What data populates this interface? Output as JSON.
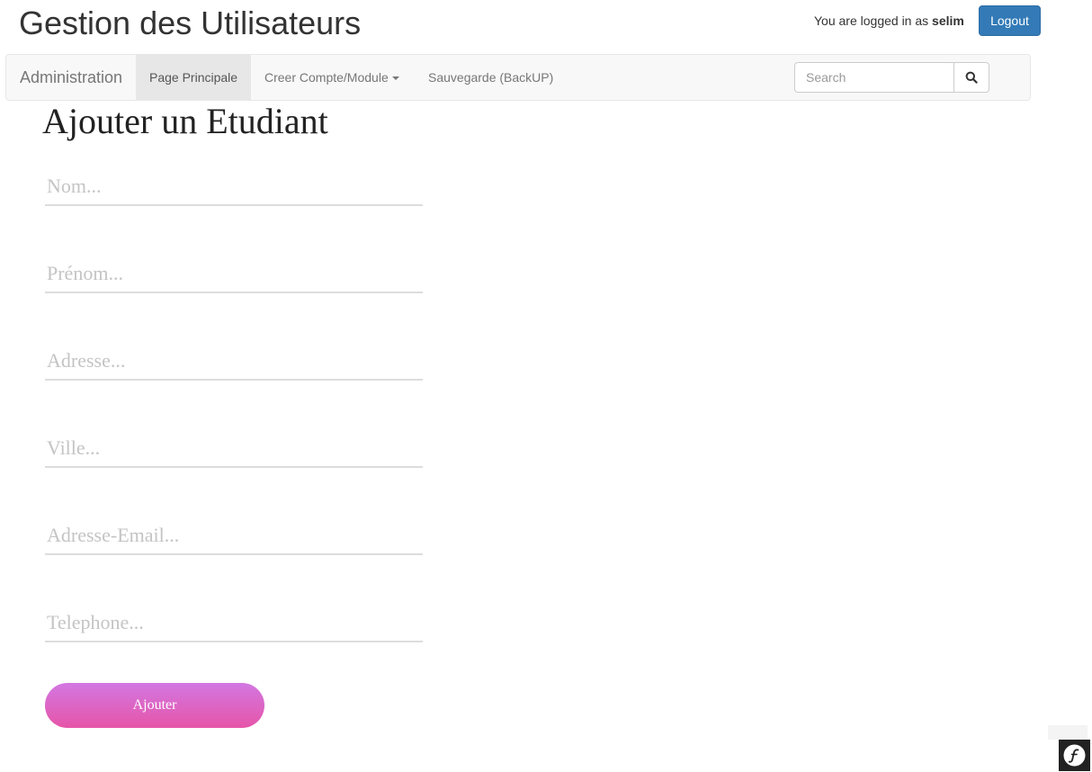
{
  "header": {
    "title": "Gestion des Utilisateurs",
    "login_prefix": "You are logged in as",
    "username": "selim",
    "logout_label": "Logout"
  },
  "navbar": {
    "brand": "Administration",
    "items": [
      {
        "label": "Page Principale",
        "active": true
      },
      {
        "label": "Creer Compte/Module",
        "dropdown": true
      },
      {
        "label": "Sauvegarde (BackUP)"
      }
    ],
    "search": {
      "placeholder": "Search",
      "icon": "search-icon"
    }
  },
  "form": {
    "title": "Ajouter un Etudiant",
    "fields": [
      {
        "name": "nom",
        "placeholder": "Nom...",
        "value": ""
      },
      {
        "name": "prenom",
        "placeholder": "Prénom...",
        "value": ""
      },
      {
        "name": "adresse",
        "placeholder": "Adresse...",
        "value": ""
      },
      {
        "name": "ville",
        "placeholder": "Ville...",
        "value": ""
      },
      {
        "name": "email",
        "placeholder": "Adresse-Email...",
        "value": ""
      },
      {
        "name": "telephone",
        "placeholder": "Telephone...",
        "value": ""
      }
    ],
    "submit_label": "Ajouter"
  },
  "debug_toolbar": {
    "icon": "symfony-logo-icon"
  },
  "colors": {
    "primary_button": "#337ab7",
    "submit_gradient_top": "#d277e2",
    "submit_gradient_bottom": "#e655a8",
    "navbar_bg": "#f8f8f8"
  }
}
